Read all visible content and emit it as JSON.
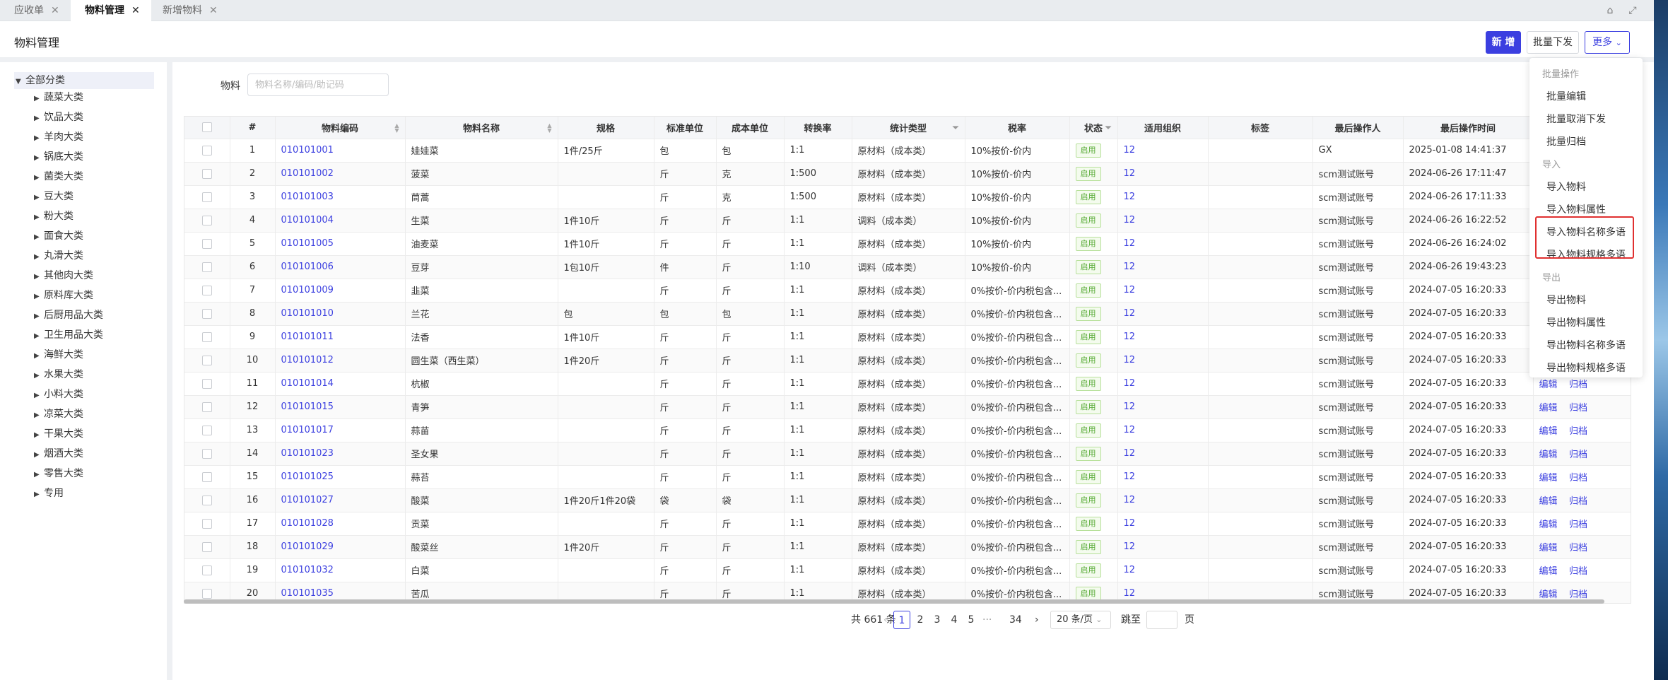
{
  "tabs": [
    {
      "label": "应收单",
      "active": false
    },
    {
      "label": "物料管理",
      "active": true
    },
    {
      "label": "新增物料",
      "active": false
    }
  ],
  "header": {
    "title": "物料管理",
    "new_label": "新 增",
    "batch_label": "批量下发",
    "more_label": "更多"
  },
  "sidebar": {
    "root": "全部分类",
    "items": [
      "蔬菜大类",
      "饮品大类",
      "羊肉大类",
      "锅底大类",
      "菌类大类",
      "豆大类",
      "粉大类",
      "面食大类",
      "丸滑大类",
      "其他肉大类",
      "原料库大类",
      "后厨用品大类",
      "卫生用品大类",
      "海鲜大类",
      "水果大类",
      "小料大类",
      "凉菜大类",
      "干果大类",
      "烟酒大类",
      "零售大类",
      "专用"
    ]
  },
  "filter": {
    "label": "物料",
    "placeholder": "物料名称/编码/助记码"
  },
  "table": {
    "columns": [
      "#",
      "物料编码",
      "物料名称",
      "规格",
      "标准单位",
      "成本单位",
      "转换率",
      "统计类型",
      "税率",
      "状态",
      "适用组织",
      "标签",
      "最后操作人",
      "最后操作时间"
    ],
    "rows": [
      [
        "1",
        "010101001",
        "娃娃菜",
        "1件/25斤",
        "包",
        "包",
        "1:1",
        "原材料（成本类）",
        "10%按价-价内",
        "启用",
        "12",
        "",
        "GX",
        "2025-01-08 14:41:37"
      ],
      [
        "2",
        "010101002",
        "菠菜",
        "",
        "斤",
        "克",
        "1:500",
        "原材料（成本类）",
        "10%按价-价内",
        "启用",
        "12",
        "",
        "scm测试账号",
        "2024-06-26 17:11:47"
      ],
      [
        "3",
        "010101003",
        "茼蒿",
        "",
        "斤",
        "克",
        "1:500",
        "原材料（成本类）",
        "10%按价-价内",
        "启用",
        "12",
        "",
        "scm测试账号",
        "2024-06-26 17:11:33"
      ],
      [
        "4",
        "010101004",
        "生菜",
        "1件10斤",
        "斤",
        "斤",
        "1:1",
        "调料（成本类）",
        "10%按价-价内",
        "启用",
        "12",
        "",
        "scm测试账号",
        "2024-06-26 16:22:52"
      ],
      [
        "5",
        "010101005",
        "油麦菜",
        "1件10斤",
        "斤",
        "斤",
        "1:1",
        "原材料（成本类）",
        "10%按价-价内",
        "启用",
        "12",
        "",
        "scm测试账号",
        "2024-06-26 16:24:02"
      ],
      [
        "6",
        "010101006",
        "豆芽",
        "1包10斤",
        "件",
        "斤",
        "1:10",
        "调料（成本类）",
        "10%按价-价内",
        "启用",
        "12",
        "",
        "scm测试账号",
        "2024-06-26 19:43:23"
      ],
      [
        "7",
        "010101009",
        "韭菜",
        "",
        "斤",
        "斤",
        "1:1",
        "原材料（成本类）",
        "0%按价-价内税包含...",
        "启用",
        "12",
        "",
        "scm测试账号",
        "2024-07-05 16:20:33"
      ],
      [
        "8",
        "010101010",
        "兰花",
        "包",
        "包",
        "包",
        "1:1",
        "原材料（成本类）",
        "0%按价-价内税包含...",
        "启用",
        "12",
        "",
        "scm测试账号",
        "2024-07-05 16:20:33"
      ],
      [
        "9",
        "010101011",
        "法香",
        "1件10斤",
        "斤",
        "斤",
        "1:1",
        "原材料（成本类）",
        "0%按价-价内税包含...",
        "启用",
        "12",
        "",
        "scm测试账号",
        "2024-07-05 16:20:33"
      ],
      [
        "10",
        "010101012",
        "圆生菜（西生菜）",
        "1件20斤",
        "斤",
        "斤",
        "1:1",
        "原材料（成本类）",
        "0%按价-价内税包含...",
        "启用",
        "12",
        "",
        "scm测试账号",
        "2024-07-05 16:20:33"
      ],
      [
        "11",
        "010101014",
        "杭椒",
        "",
        "斤",
        "斤",
        "1:1",
        "原材料（成本类）",
        "0%按价-价内税包含...",
        "启用",
        "12",
        "",
        "scm测试账号",
        "2024-07-05 16:20:33"
      ],
      [
        "12",
        "010101015",
        "青笋",
        "",
        "斤",
        "斤",
        "1:1",
        "原材料（成本类）",
        "0%按价-价内税包含...",
        "启用",
        "12",
        "",
        "scm测试账号",
        "2024-07-05 16:20:33"
      ],
      [
        "13",
        "010101017",
        "蒜苗",
        "",
        "斤",
        "斤",
        "1:1",
        "原材料（成本类）",
        "0%按价-价内税包含...",
        "启用",
        "12",
        "",
        "scm测试账号",
        "2024-07-05 16:20:33"
      ],
      [
        "14",
        "010101023",
        "圣女果",
        "",
        "斤",
        "斤",
        "1:1",
        "原材料（成本类）",
        "0%按价-价内税包含...",
        "启用",
        "12",
        "",
        "scm测试账号",
        "2024-07-05 16:20:33"
      ],
      [
        "15",
        "010101025",
        "蒜苔",
        "",
        "斤",
        "斤",
        "1:1",
        "原材料（成本类）",
        "0%按价-价内税包含...",
        "启用",
        "12",
        "",
        "scm测试账号",
        "2024-07-05 16:20:33"
      ],
      [
        "16",
        "010101027",
        "酸菜",
        "1件20斤1件20袋",
        "袋",
        "袋",
        "1:1",
        "原材料（成本类）",
        "0%按价-价内税包含...",
        "启用",
        "12",
        "",
        "scm测试账号",
        "2024-07-05 16:20:33"
      ],
      [
        "17",
        "010101028",
        "贡菜",
        "",
        "斤",
        "斤",
        "1:1",
        "原材料（成本类）",
        "0%按价-价内税包含...",
        "启用",
        "12",
        "",
        "scm测试账号",
        "2024-07-05 16:20:33"
      ],
      [
        "18",
        "010101029",
        "酸菜丝",
        "1件20斤",
        "斤",
        "斤",
        "1:1",
        "原材料（成本类）",
        "0%按价-价内税包含...",
        "启用",
        "12",
        "",
        "scm测试账号",
        "2024-07-05 16:20:33"
      ],
      [
        "19",
        "010101032",
        "白菜",
        "",
        "斤",
        "斤",
        "1:1",
        "原材料（成本类）",
        "0%按价-价内税包含...",
        "启用",
        "12",
        "",
        "scm测试账号",
        "2024-07-05 16:20:33"
      ],
      [
        "20",
        "010101035",
        "苦瓜",
        "",
        "斤",
        "斤",
        "1:1",
        "原材料（成本类）",
        "0%按价-价内税包含...",
        "启用",
        "12",
        "",
        "scm测试账号",
        "2024-07-05 16:20:33"
      ]
    ],
    "action_edit": "编辑",
    "action_archive": "归档"
  },
  "pagination": {
    "total": "共 661 条",
    "pages": [
      "1",
      "2",
      "3",
      "4",
      "5"
    ],
    "ellipsis": "···",
    "last": "34",
    "page_size": "20 条/页",
    "jump_label": "跳至",
    "page_unit": "页"
  },
  "dropdown": {
    "groups": [
      {
        "title": "批量操作",
        "items": [
          "批量编辑",
          "批量取消下发",
          "批量归档"
        ]
      },
      {
        "title": "导入",
        "items": [
          "导入物料",
          "导入物料属性",
          "导入物料名称多语",
          "导入物料规格多语"
        ]
      },
      {
        "title": "导出",
        "items": [
          "导出物料",
          "导出物料属性",
          "导出物料名称多语",
          "导出物料规格多语"
        ]
      }
    ]
  }
}
